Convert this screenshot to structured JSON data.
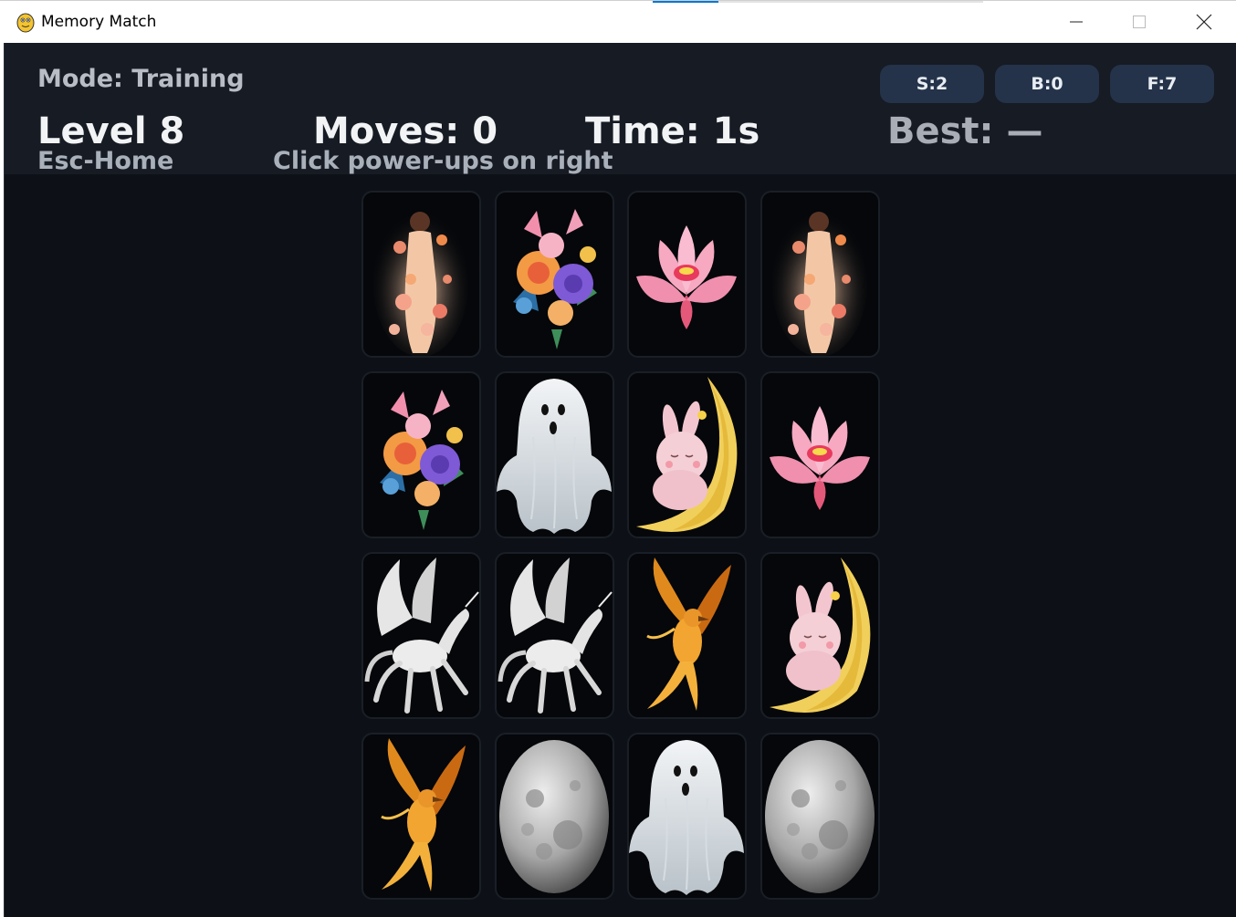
{
  "window": {
    "title": "Memory Match",
    "icon": "python-snake-icon",
    "controls": [
      "minimize-icon",
      "maximize-icon",
      "close-icon"
    ]
  },
  "hud": {
    "mode": "Mode: Training",
    "level": "Level 8",
    "moves": "Moves: 0",
    "time": "Time: 1s",
    "best": "Best: —",
    "escape_hint": "Esc-Home",
    "powerup_hint": "Click power-ups on right"
  },
  "powerups": [
    {
      "key": "s",
      "label": "S:2"
    },
    {
      "key": "b",
      "label": "B:0"
    },
    {
      "key": "f",
      "label": "F:7"
    }
  ],
  "board": {
    "rows": 4,
    "cols": 4,
    "cards": [
      [
        "woman-with-flowers",
        "flower-bouquet",
        "pink-lotus",
        "woman-with-flowers"
      ],
      [
        "flower-bouquet",
        "ghost",
        "bunny-on-moon",
        "pink-lotus"
      ],
      [
        "pegasus",
        "pegasus",
        "phoenix-bird",
        "bunny-on-moon"
      ],
      [
        "phoenix-bird",
        "full-moon",
        "ghost",
        "full-moon"
      ]
    ]
  },
  "colors": {
    "background": "#0d1117",
    "hud": "#161b24",
    "powerup": "#243349",
    "text": "#f2f3f5"
  }
}
